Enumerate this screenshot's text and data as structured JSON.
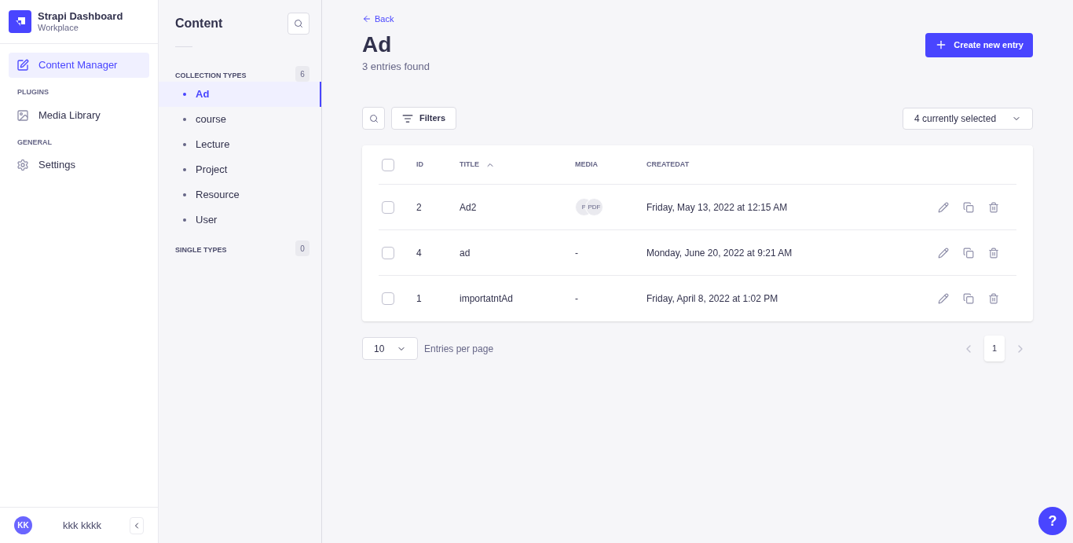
{
  "brand": {
    "title": "Strapi Dashboard",
    "subtitle": "Workplace"
  },
  "nav": [
    {
      "kind": "item",
      "label": "Content Manager",
      "selected": true
    },
    {
      "kind": "heading",
      "label": "PLUGINS"
    },
    {
      "kind": "item",
      "label": "Media Library",
      "selected": false
    },
    {
      "kind": "heading",
      "label": "GENERAL"
    },
    {
      "kind": "item",
      "label": "Settings",
      "selected": false
    }
  ],
  "user": {
    "initials": "KK",
    "name": "kkk kkkk"
  },
  "content_panel": {
    "title": "Content",
    "sections": [
      {
        "label": "COLLECTION TYPES",
        "count": "6",
        "items": [
          {
            "label": "Ad",
            "selected": true
          },
          {
            "label": "course",
            "selected": false
          },
          {
            "label": "Lecture",
            "selected": false
          },
          {
            "label": "Project",
            "selected": false
          },
          {
            "label": "Resource",
            "selected": false
          },
          {
            "label": "User",
            "selected": false
          }
        ]
      },
      {
        "label": "SINGLE TYPES",
        "count": "0"
      }
    ]
  },
  "header": {
    "back": "Back",
    "title": "Ad",
    "subtitle": "3 entries found",
    "create_button": "Create new entry"
  },
  "toolbar": {
    "filters": "Filters",
    "columns_select": "4 currently selected"
  },
  "table": {
    "all_checked": false,
    "columns": [
      {
        "label": "ID",
        "sorted": false
      },
      {
        "label": "TITLE",
        "sorted": true
      },
      {
        "label": "MEDIA",
        "sorted": false
      },
      {
        "label": "CREATEDAT",
        "sorted": false
      }
    ],
    "rows": [
      {
        "checked": false,
        "id": "2",
        "title": "Ad2",
        "media": [
          "P",
          "PDF"
        ],
        "created": "Friday, May 13, 2022 at 12:15 AM"
      },
      {
        "checked": false,
        "id": "4",
        "title": "ad",
        "media_text": "-",
        "created": "Monday, June 20, 2022 at 9:21 AM"
      },
      {
        "checked": false,
        "id": "1",
        "title": "importatntAd",
        "media_text": "-",
        "created": "Friday, April 8, 2022 at 1:02 PM"
      }
    ]
  },
  "pagination": {
    "page_size": "10",
    "page_size_label": "Entries per page",
    "pages": [
      {
        "label": "1",
        "selected": true
      }
    ]
  },
  "help_button": "?"
}
